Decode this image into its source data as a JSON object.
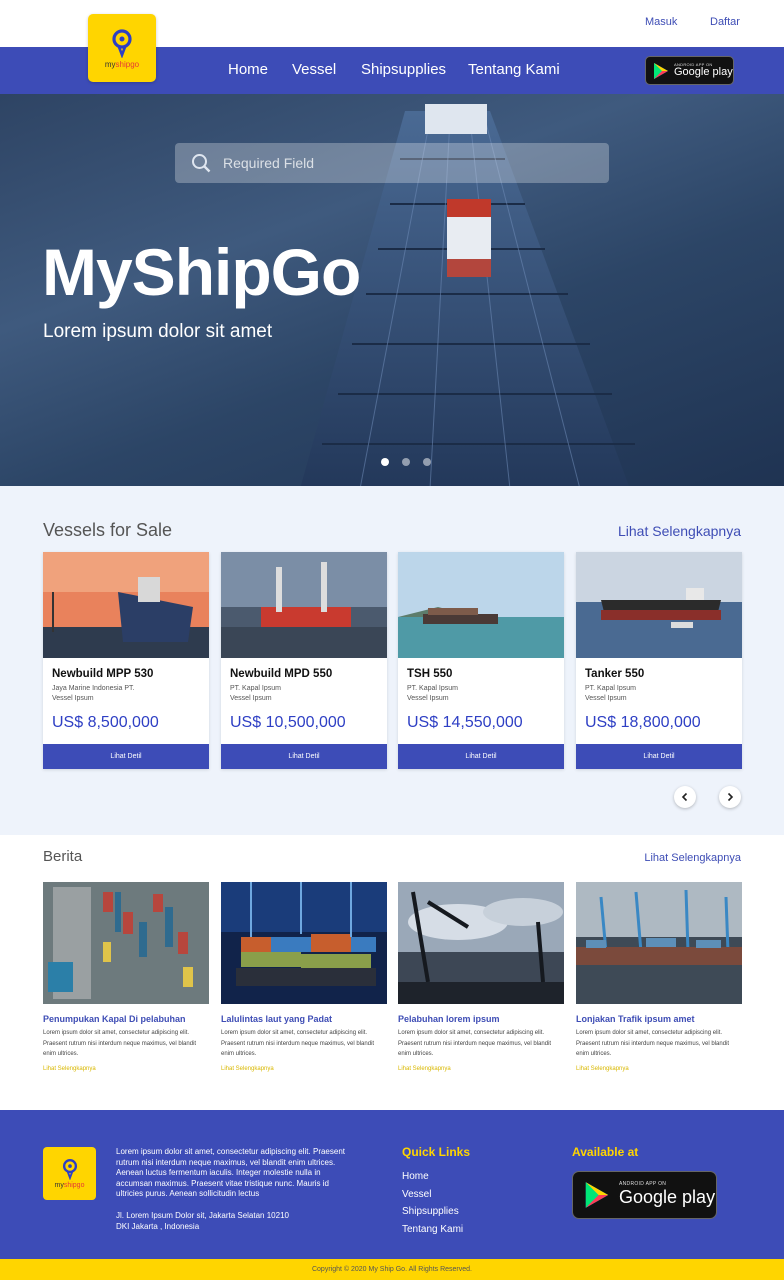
{
  "header": {
    "login": "Masuk",
    "register": "Daftar",
    "logo_text_prefix": "my",
    "logo_text_accent": "shipgo",
    "nav": [
      "Home",
      "Vessel",
      "Shipsupplies",
      "Tentang Kami"
    ],
    "store_small": "ANDROID APP ON",
    "store_big": "Google play"
  },
  "hero": {
    "search_placeholder": "Required Field",
    "title": "MyShipGo",
    "subtitle": "Lorem ipsum dolor sit amet",
    "slides_total": 3,
    "slide_active": 1
  },
  "vessels": {
    "title": "Vessels for Sale",
    "more": "Lihat Selengkapnya",
    "button_label": "Lihat Detil",
    "items": [
      {
        "name": "Newbuild MPP 530",
        "company": "Jaya Marine Indonesia PT.",
        "sub": "Vessel Ipsum",
        "price": "US$ 8,500,000"
      },
      {
        "name": "Newbuild MPD 550",
        "company": "PT. Kapal Ipsum",
        "sub": "Vessel Ipsum",
        "price": "US$ 10,500,000"
      },
      {
        "name": "TSH 550",
        "company": "PT. Kapal Ipsum",
        "sub": "Vessel Ipsum",
        "price": "US$ 14,550,000"
      },
      {
        "name": "Tanker 550",
        "company": "PT. Kapal Ipsum",
        "sub": "Vessel Ipsum",
        "price": "US$ 18,800,000"
      }
    ]
  },
  "news": {
    "title": "Berita",
    "more": "Lihat Selengkapnya",
    "link_label": "Lihat Selengkapnya",
    "items": [
      {
        "title": "Penumpukan Kapal Di pelabuhan",
        "body": "Lorem ipsum dolor sit amet, consectetur adipiscing elit. Praesent rutrum nisi interdum neque maximus, vel blandit enim ultrices."
      },
      {
        "title": "Lalulintas laut yang Padat",
        "body": "Lorem ipsum dolor sit amet, consectetur adipiscing elit. Praesent rutrum nisi interdum neque maximus, vel blandit enim ultrices."
      },
      {
        "title": "Pelabuhan lorem ipsum",
        "body": "Lorem ipsum dolor sit amet, consectetur adipiscing elit. Praesent rutrum nisi interdum neque maximus, vel blandit enim ultrices."
      },
      {
        "title": "Lonjakan Trafik ipsum amet",
        "body": "Lorem ipsum dolor sit amet, consectetur adipiscing elit. Praesent rutrum nisi interdum neque maximus, vel blandit enim ultrices."
      }
    ]
  },
  "footer": {
    "description": "Lorem ipsum dolor sit amet, consectetur adipiscing elit. Praesent rutrum nisi interdum neque maximus, vel blandit enim ultrices. Aenean luctus fermentum iaculis. Integer molestie nulla in accumsan maximus. Praesent vitae tristique nunc. Mauris id ultricies purus. Aenean sollicitudin lectus",
    "address_line1": "Jl. Lorem Ipsum Dolor sit, Jakarta Selatan 10210",
    "address_line2": "DKI Jakarta , Indonesia",
    "quick_links_title": "Quick Links",
    "quick_links": [
      "Home",
      "Vessel",
      "Shipsupplies",
      "Tentang Kami"
    ],
    "available_title": "Available at",
    "copyright": "Copyright © 2020 My Ship Go. All Rights Reserved."
  },
  "colors": {
    "brand_blue": "#3d4cb7",
    "brand_yellow": "#ffd500",
    "price_blue": "#2e3fc4"
  }
}
